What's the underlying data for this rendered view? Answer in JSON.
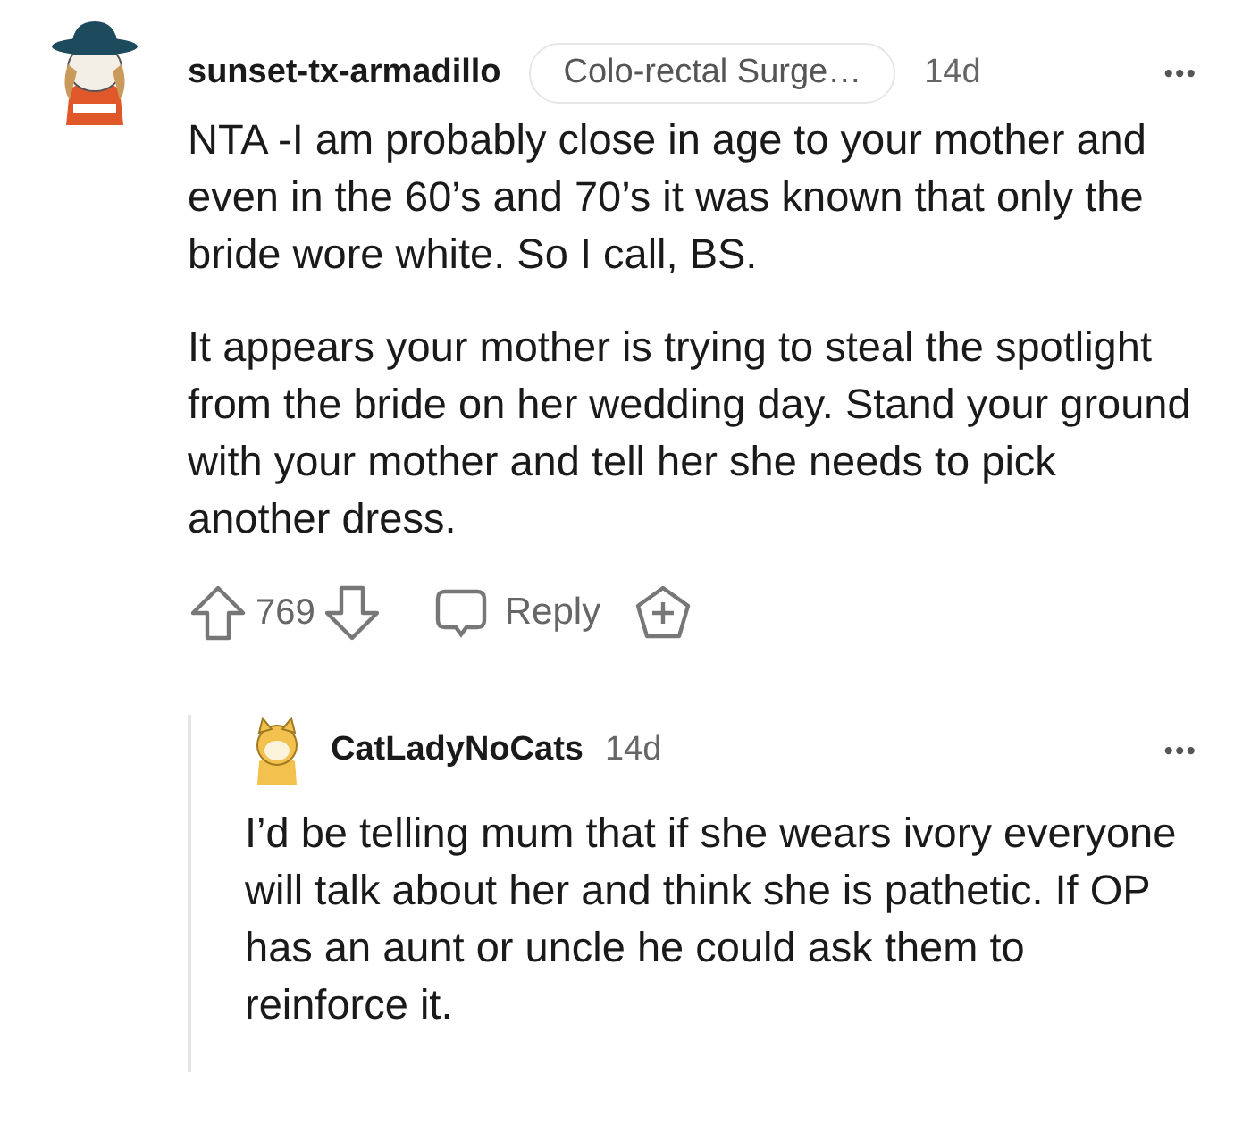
{
  "comment": {
    "author": "sunset-tx-armadillo",
    "flair": "Colo-rectal Surge…",
    "age": "14d",
    "more": "•••",
    "paragraphs": [
      "NTA -I am probably close in age to your mother and even in the 60’s and 70’s it was known that only the bride wore white. So I call, BS.",
      "It appears your mother is trying to steal the spotlight from the bride on her wedding day. Stand your ground with your mother and tell her she needs to pick another dress."
    ],
    "score": "769",
    "reply_label": "Reply"
  },
  "reply": {
    "author": "CatLadyNoCats",
    "age": "14d",
    "more": "•••",
    "paragraphs": [
      "I’d be telling mum that if she wears ivory everyone will talk about her and think she is pathetic. If OP has an aunt or uncle he could ask them to reinforce it."
    ]
  }
}
